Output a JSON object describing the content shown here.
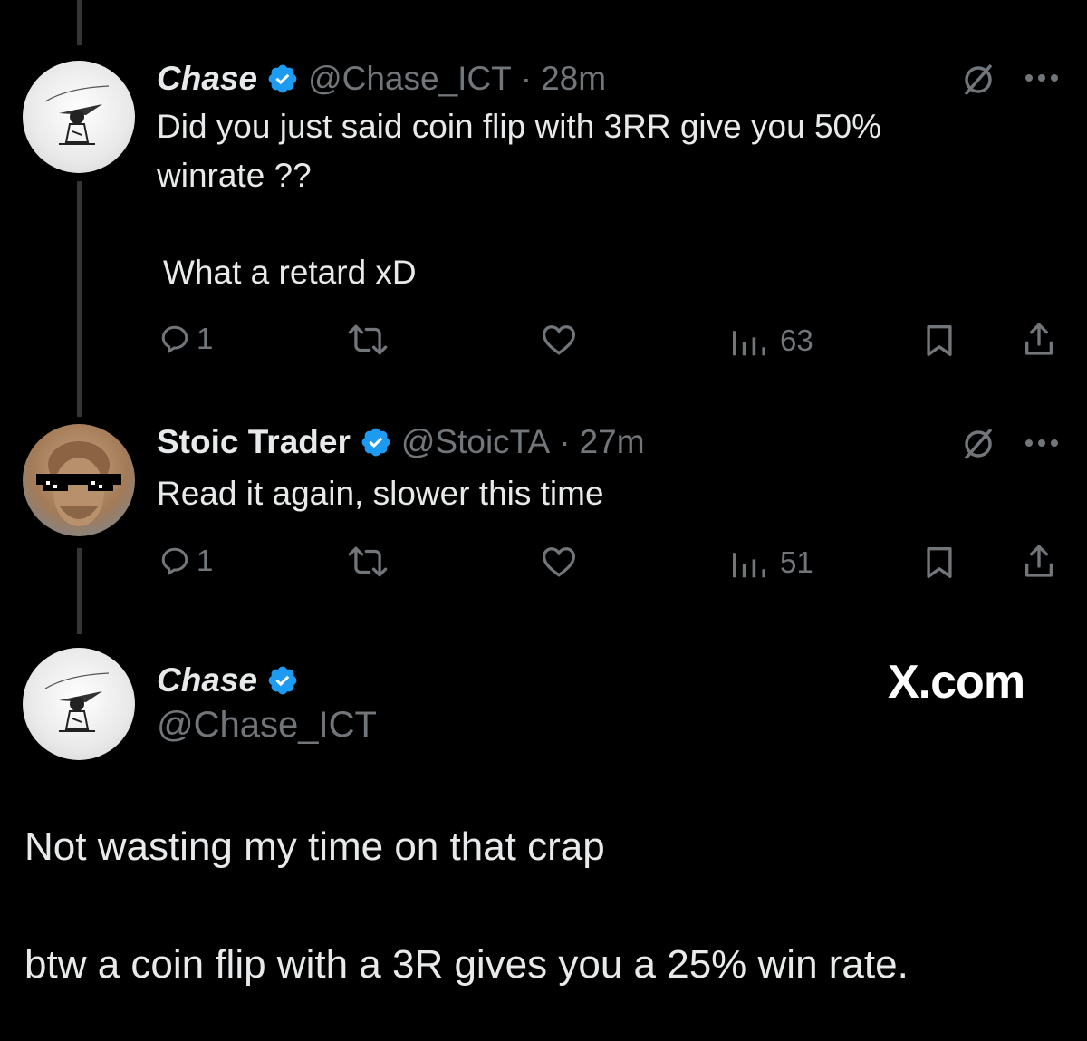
{
  "tweets": [
    {
      "name": "Chase",
      "handle": "@Chase_ICT",
      "separator": "·",
      "time": "28m",
      "text_line1": "Did you just said coin flip with 3RR give you 50%",
      "text_line2": "winrate ??",
      "text_line3": "What a retard xD",
      "replies": "1",
      "views": "63"
    },
    {
      "name": "Stoic Trader",
      "handle": "@StoicTA",
      "separator": "·",
      "time": "27m",
      "text_line1": "Read it again, slower this time",
      "replies": "1",
      "views": "51"
    }
  ],
  "main_post": {
    "name": "Chase",
    "handle": "@Chase_ICT",
    "watermark": "X.com",
    "text_line1": "Not wasting my time on that crap",
    "text_line2": "btw a coin flip with a 3R gives you a 25% win rate."
  },
  "colors": {
    "background": "#000000",
    "text": "#e7e9ea",
    "muted": "#71767b",
    "verified": "#1d9bf0",
    "thread_line": "#333639"
  },
  "icons": [
    "verified-badge-icon",
    "grok-icon",
    "more-icon",
    "reply-icon",
    "retweet-icon",
    "like-icon",
    "views-icon",
    "bookmark-icon",
    "share-icon"
  ]
}
